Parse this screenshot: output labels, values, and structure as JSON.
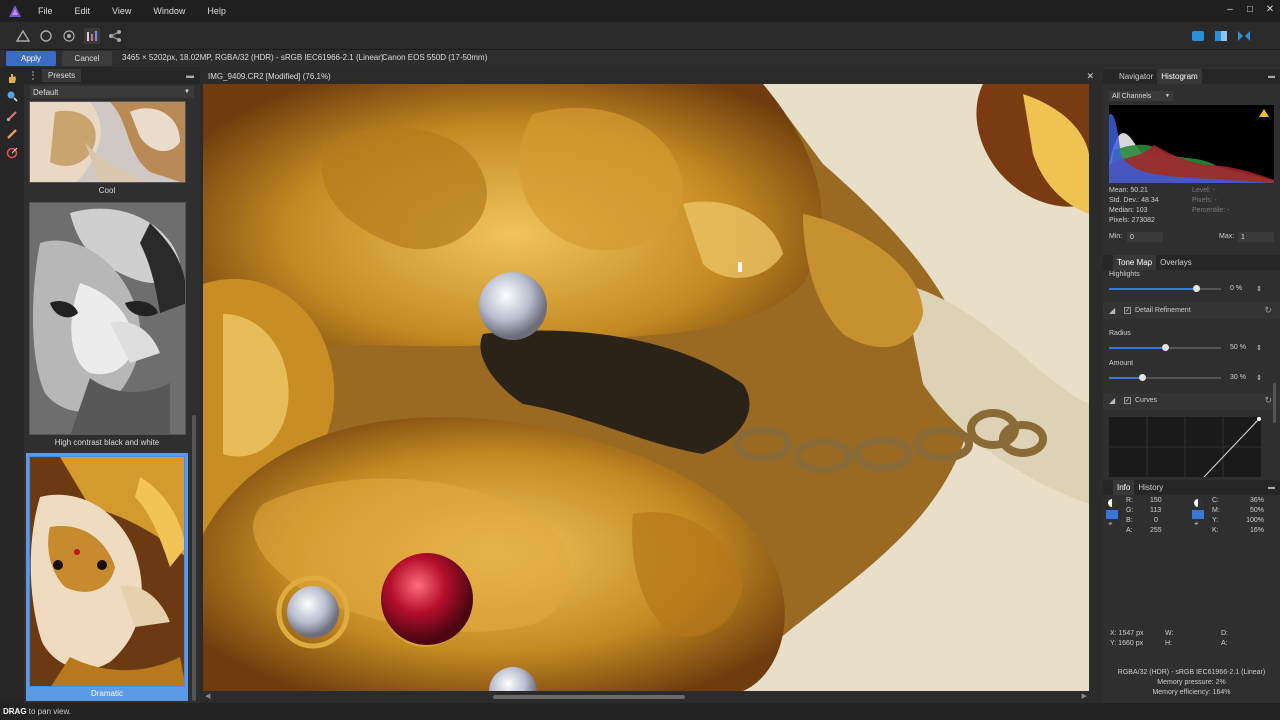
{
  "menu": {
    "items": [
      "File",
      "Edit",
      "View",
      "Window",
      "Help"
    ]
  },
  "window_controls": {
    "minimize": "–",
    "maximize": "□",
    "close": "✕"
  },
  "context": {
    "apply": "Apply",
    "cancel": "Cancel",
    "image_info": "3465 × 5202px, 18.02MP, RGBA/32 (HDR) - sRGB IEC61966-2.1 (Linear)",
    "camera": "Canon EOS 550D (17-50mm)"
  },
  "presets": {
    "tab": "Presets",
    "selected": "Default",
    "items": [
      {
        "label": "Cool"
      },
      {
        "label": "High contrast black and white"
      },
      {
        "label": "Dramatic"
      }
    ]
  },
  "document": {
    "title": "IMG_9409.CR2 [Modified] (76.1%)"
  },
  "navigator": {
    "tabs": [
      "Navigator",
      "Histogram"
    ],
    "active": "Histogram",
    "channel": "All Channels",
    "stats": {
      "mean": "Mean: 50.21",
      "std": "Std. Dev.: 48.34",
      "median": "Median: 103",
      "pixels": "Pixels: 273082",
      "level": "Level: -",
      "pixels_r": "Pixels: -",
      "percentile": "Percentile: -"
    },
    "min_label": "Min:",
    "min_value": "0",
    "max_label": "Max:",
    "max_value": "1"
  },
  "tonemap": {
    "tabs": [
      "Tone Map",
      "Overlays"
    ],
    "highlights_label": "Highlights",
    "highlights_value": "0 %",
    "highlights_level": 0.78,
    "detail_label": "Detail Refinement",
    "radius_label": "Radius",
    "radius_value": "50 %",
    "radius_level": 0.5,
    "amount_label": "Amount",
    "amount_value": "30 %",
    "amount_level": 0.3,
    "curves_label": "Curves"
  },
  "info": {
    "tabs": [
      "Info",
      "History"
    ],
    "rgb": [
      {
        "k": "R:",
        "v": "150"
      },
      {
        "k": "G:",
        "v": "113"
      },
      {
        "k": "B:",
        "v": "0"
      },
      {
        "k": "A:",
        "v": "255"
      }
    ],
    "cmyk": [
      {
        "k": "C:",
        "v": "36%"
      },
      {
        "k": "M:",
        "v": "50%"
      },
      {
        "k": "Y:",
        "v": "100%"
      },
      {
        "k": "K:",
        "v": "16%"
      }
    ],
    "x": "X: 1547 px",
    "y": "Y: 1660 px",
    "w": "W:",
    "h": "H:",
    "d": "D:",
    "a": "A:",
    "format": "RGBA/32 (HDR) - sRGB IEC61966-2.1 (Linear)",
    "memory_pressure": "Memory pressure: 2%",
    "memory_efficiency": "Memory efficiency: 164%"
  },
  "status": {
    "key": "DRAG",
    "text": " to pan view."
  },
  "colors": {
    "accent": "#3c6ac7",
    "selected_preset_border": "#4a8be0"
  }
}
